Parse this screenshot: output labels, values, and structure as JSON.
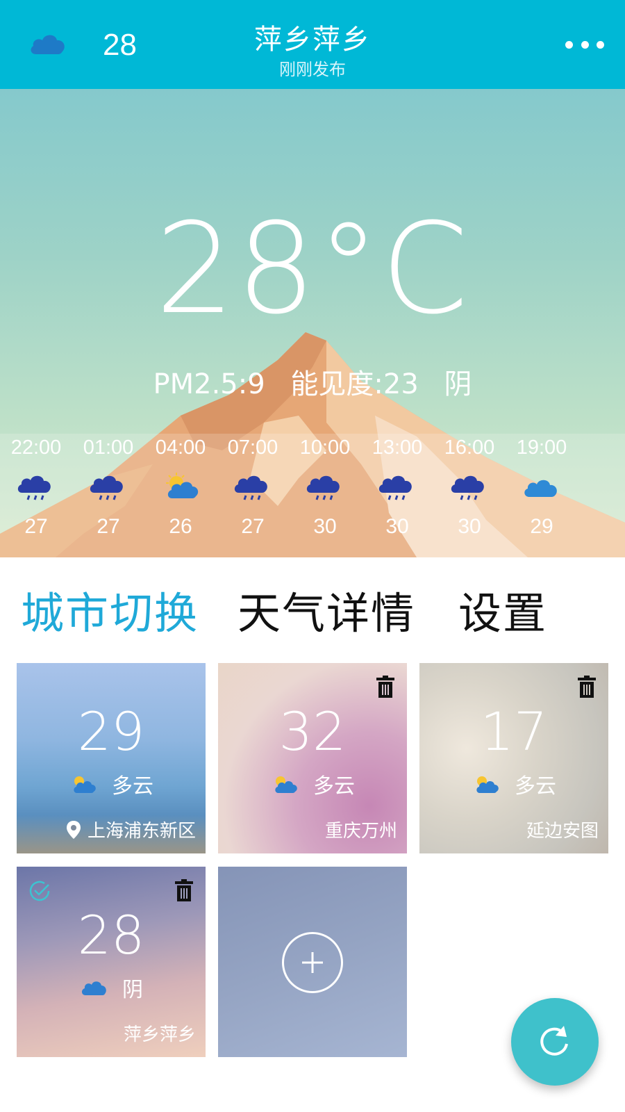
{
  "colors": {
    "header": "#00b8d6",
    "accent": "#1fa9d8",
    "fab": "#3fc1cb"
  },
  "header": {
    "icon": "cloud-icon",
    "temp": "28",
    "city": "萍乡萍乡",
    "status": "刚刚发布",
    "menu_icon": "more-icon"
  },
  "current": {
    "temp": "28°C",
    "pm25": "PM2.5:9",
    "visibility": "能见度:23",
    "weather": "阴"
  },
  "hourly": [
    {
      "time": "22:00",
      "icon": "rain-icon",
      "temp": "27"
    },
    {
      "time": "01:00",
      "icon": "rain-icon",
      "temp": "27"
    },
    {
      "time": "04:00",
      "icon": "partly-cloudy-icon",
      "temp": "26"
    },
    {
      "time": "07:00",
      "icon": "rain-icon",
      "temp": "27"
    },
    {
      "time": "10:00",
      "icon": "rain-icon",
      "temp": "30"
    },
    {
      "time": "13:00",
      "icon": "rain-icon",
      "temp": "30"
    },
    {
      "time": "16:00",
      "icon": "rain-icon",
      "temp": "30"
    },
    {
      "time": "19:00",
      "icon": "cloud-icon",
      "temp": "29"
    }
  ],
  "tabs": [
    {
      "label": "城市切换",
      "active": true
    },
    {
      "label": "天气详情",
      "active": false
    },
    {
      "label": "设置",
      "active": false
    }
  ],
  "cities": [
    {
      "temp": "29",
      "weather": "多云",
      "name": "上海浦东新区",
      "location_icon": "location-pin-icon"
    },
    {
      "temp": "32",
      "weather": "多云",
      "name": "重庆万州",
      "delete_icon": "trash-icon"
    },
    {
      "temp": "17",
      "weather": "多云",
      "name": "延边安图",
      "delete_icon": "trash-icon"
    },
    {
      "temp": "28",
      "weather": "阴",
      "name": "萍乡萍乡",
      "delete_icon": "trash-icon",
      "selected_icon": "check-circle-icon"
    }
  ],
  "add_city_icon": "plus-circle-icon",
  "refresh_icon": "refresh-icon"
}
